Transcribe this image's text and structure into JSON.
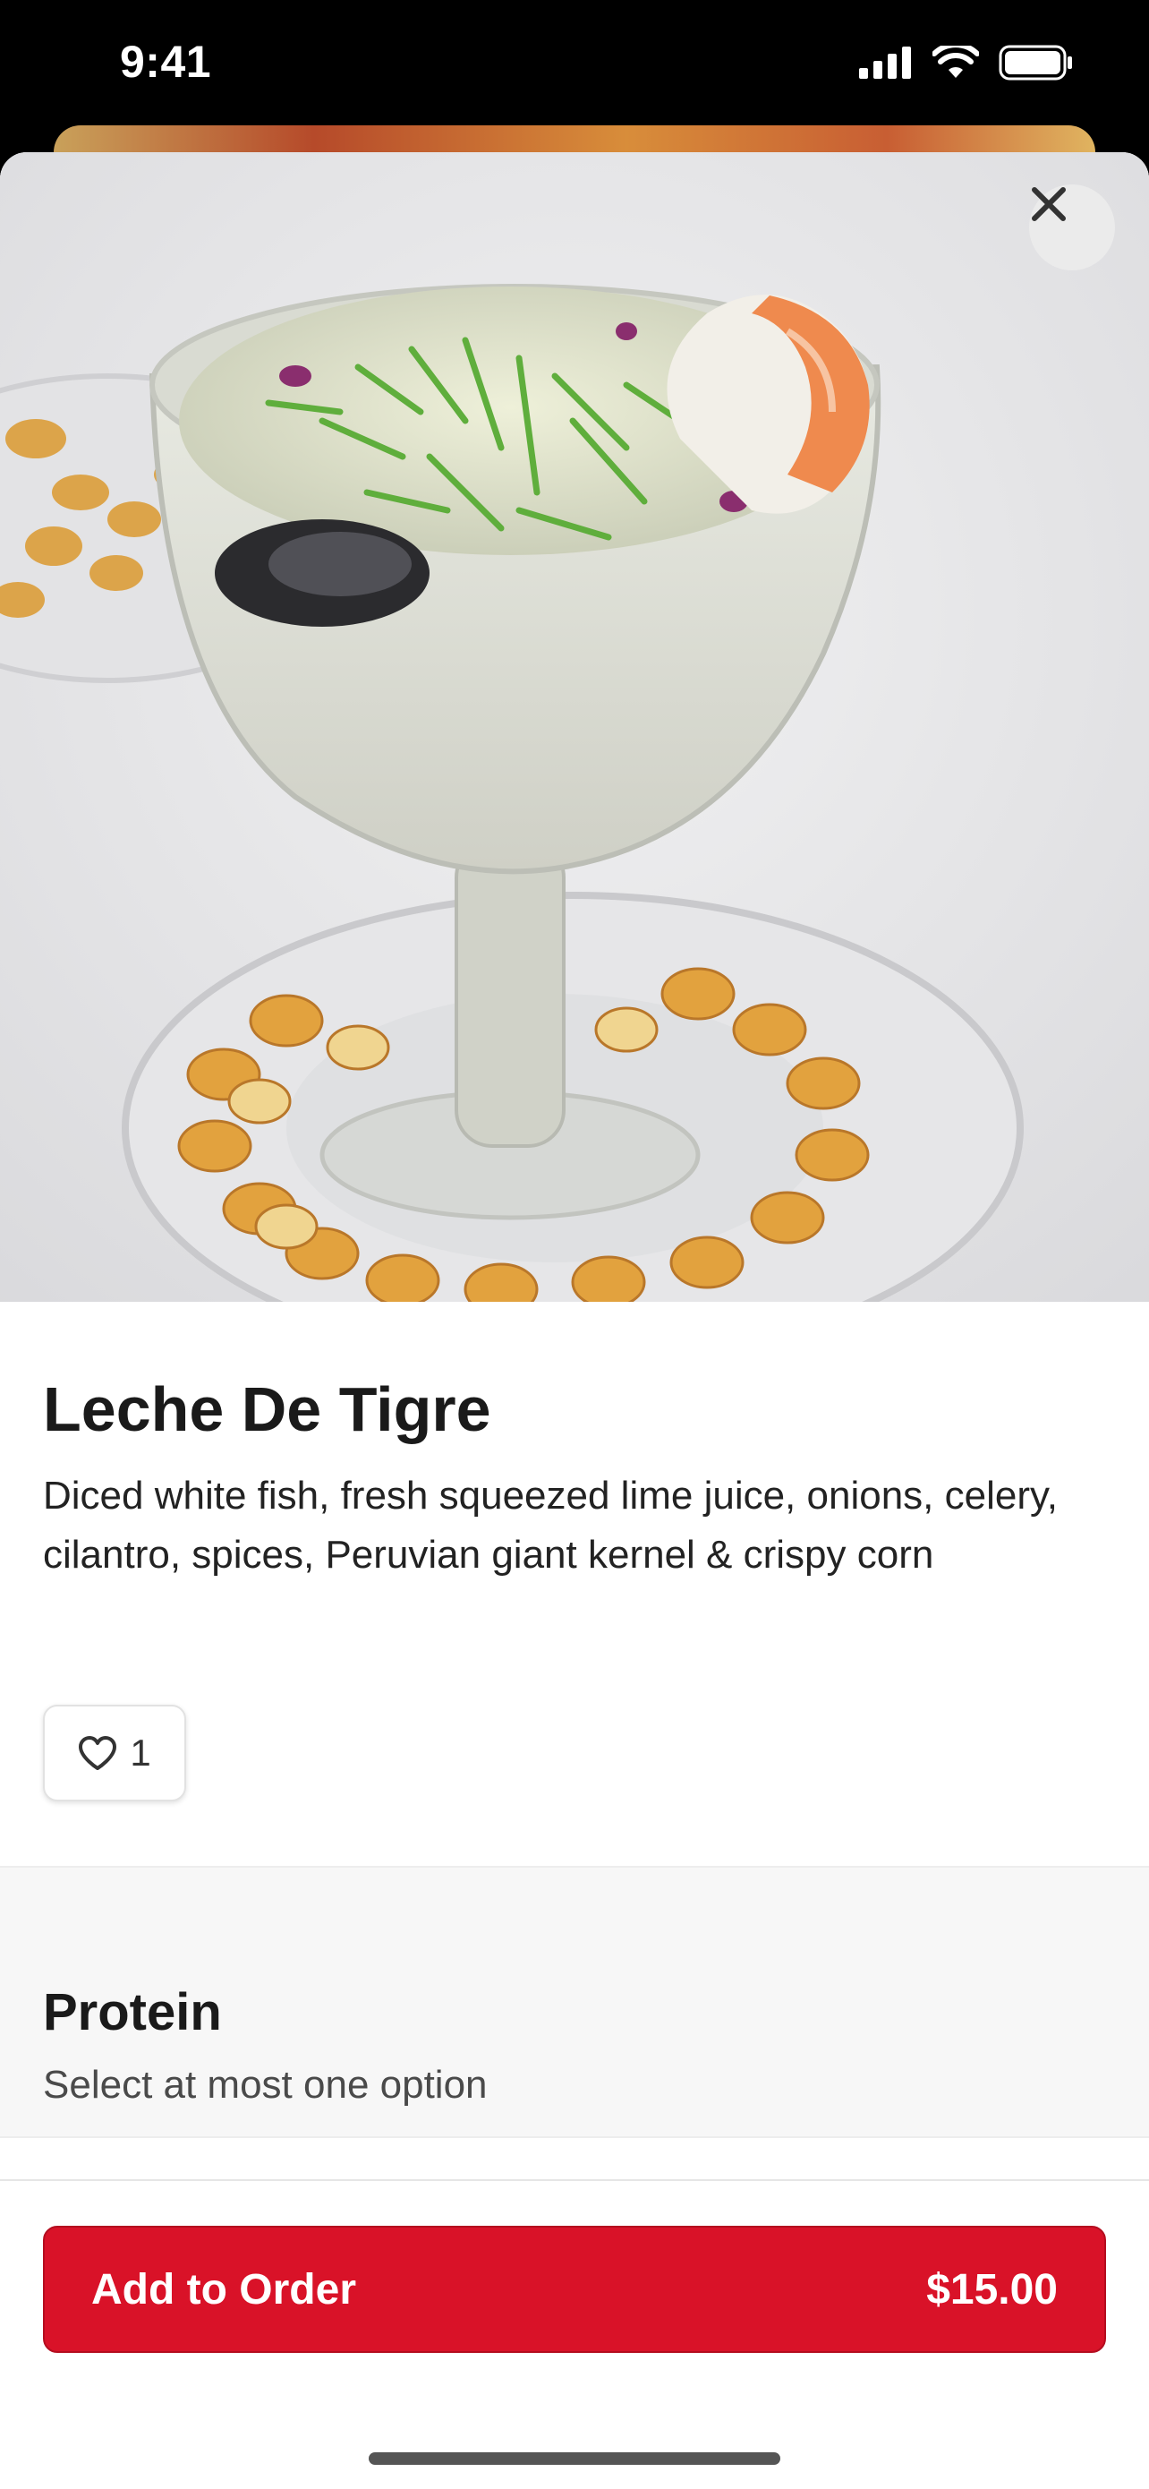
{
  "status_bar": {
    "time": "9:41"
  },
  "item": {
    "title": "Leche De Tigre",
    "description": "Diced white fish, fresh squeezed lime juice, onions, celery, cilantro, spices, Peruvian giant kernel & crispy corn",
    "likes": "1"
  },
  "protein": {
    "title": "Protein",
    "subtitle": "Select at most one option"
  },
  "footer": {
    "add_label": "Add to Order",
    "price": "$15.00"
  },
  "colors": {
    "accent": "#d91228",
    "section_bg": "#f7f7f7"
  },
  "icons": [
    "signal-icon",
    "wifi-icon",
    "battery-icon",
    "close-icon",
    "heart-icon"
  ]
}
